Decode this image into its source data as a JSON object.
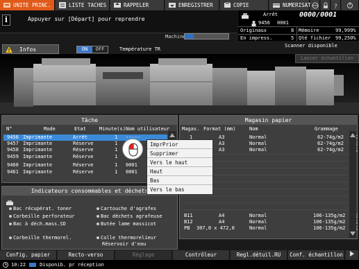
{
  "tabs": [
    {
      "label": "UNITE PRINC.",
      "icon": "home-icon",
      "active": true
    },
    {
      "label": "LISTE TACHES",
      "icon": "list-icon",
      "active": false
    },
    {
      "label": "RAPPELER",
      "icon": "recall-icon",
      "active": false
    },
    {
      "label": "ENREGISTRER",
      "icon": "save-icon",
      "active": false
    },
    {
      "label": "COPIE",
      "icon": "copy-icon",
      "active": false
    },
    {
      "label": "NUMERISATION",
      "icon": "scan-icon",
      "active": false
    }
  ],
  "message": "Appuyer sur [Départ] pour reprendre",
  "machine": {
    "label": "Machine",
    "progress_pct": 20
  },
  "status": {
    "state": "Arrêt",
    "counter": "0000/0001",
    "user_id": "9456",
    "job_no": "0001",
    "originaux_label": "Originaux",
    "originaux_value": "8",
    "memoire_label": "Mémoire",
    "memoire_value": "99,999%",
    "en_impress_label": "En impress.",
    "en_impress_value": "5",
    "qte_fichier_label": "Qté fichier",
    "qte_fichier_value": "99,250%"
  },
  "infos_label": "Infos",
  "toggle": {
    "on": "ON",
    "off": "OFF"
  },
  "temperature_label": "Température TR",
  "scanner_label": "Scanner disponible",
  "cancel_sample_label": "Lancer échantillon",
  "tache": {
    "title": "Tâche",
    "columns": [
      "N°",
      "Mode",
      "Etat",
      "Minute(s)",
      "Nom utilisateur"
    ],
    "rows": [
      {
        "n": "9456",
        "mode": "Imprimante",
        "etat": "Arrêt",
        "min": "1",
        "user": "-----",
        "selected": true
      },
      {
        "n": "9457",
        "mode": "Imprimante",
        "etat": "Réserve",
        "min": "1",
        "user": "",
        "selected": false
      },
      {
        "n": "9458",
        "mode": "Imprimante",
        "etat": "Réserve",
        "min": "1",
        "user": "",
        "selected": false
      },
      {
        "n": "9459",
        "mode": "Imprimante",
        "etat": "Réserve",
        "min": "1",
        "user": "",
        "selected": false
      },
      {
        "n": "9460",
        "mode": "Imprimante",
        "etat": "Réserve",
        "min": "1",
        "user": "0001",
        "selected": false
      },
      {
        "n": "9461",
        "mode": "Imprimante",
        "etat": "Réserve",
        "min": "1",
        "user": "0001",
        "selected": false
      }
    ]
  },
  "context_menu": [
    "ImprPrior",
    "Supprimer",
    "Vers le haut",
    "Haut",
    "Bas",
    "Vers le bas"
  ],
  "magasin": {
    "title": "Magasin papier",
    "columns": [
      "Magas.",
      "Format (mm)",
      "Nom",
      "Grammage"
    ],
    "rows": [
      {
        "mag": "1",
        "format": "A3",
        "nom": "Normal",
        "gram": "62-74g/m2"
      },
      {
        "mag": "2",
        "format": "A3",
        "nom": "Normal",
        "gram": "62-74g/m2"
      },
      {
        "mag": "3",
        "format": "A3",
        "nom": "Normal",
        "gram": "62-74g/m2"
      }
    ],
    "bottom_rows": [
      {
        "mag": "B11",
        "format": "A4",
        "nom": "Normal",
        "gram": "106-135g/m2"
      },
      {
        "mag": "B12",
        "format": "A4",
        "nom": "Normal",
        "gram": "106-135g/m2"
      },
      {
        "mag": "PB",
        "format": "307,0 x 472,0",
        "nom": "Normal",
        "gram": "106-135g/m2"
      }
    ]
  },
  "consommables": {
    "title": "Indicateurs consommables et déchets",
    "left": [
      "Bac récupérat. toner",
      "Corbeille perforateur",
      "Bac à déch.mass.SD",
      "Corbeille thermorel."
    ],
    "right": [
      "Cartouche d'agrafes",
      "Bac déchets agrafeuse",
      "Butée lame massicot",
      "Colle thermorelieur",
      "Réservoir d'eau"
    ]
  },
  "bottom_buttons": [
    "Config. papier",
    "Recto-verso",
    "Réglage",
    "Contrôleur",
    "Regl.détuil.RU",
    "Conf. échantillon"
  ],
  "footer": {
    "time": "10:22",
    "text": "Disponib. pr réception"
  },
  "colors": {
    "accent": "#e05a1a",
    "selection": "#3b8ad8",
    "on": "#3b79c9"
  }
}
